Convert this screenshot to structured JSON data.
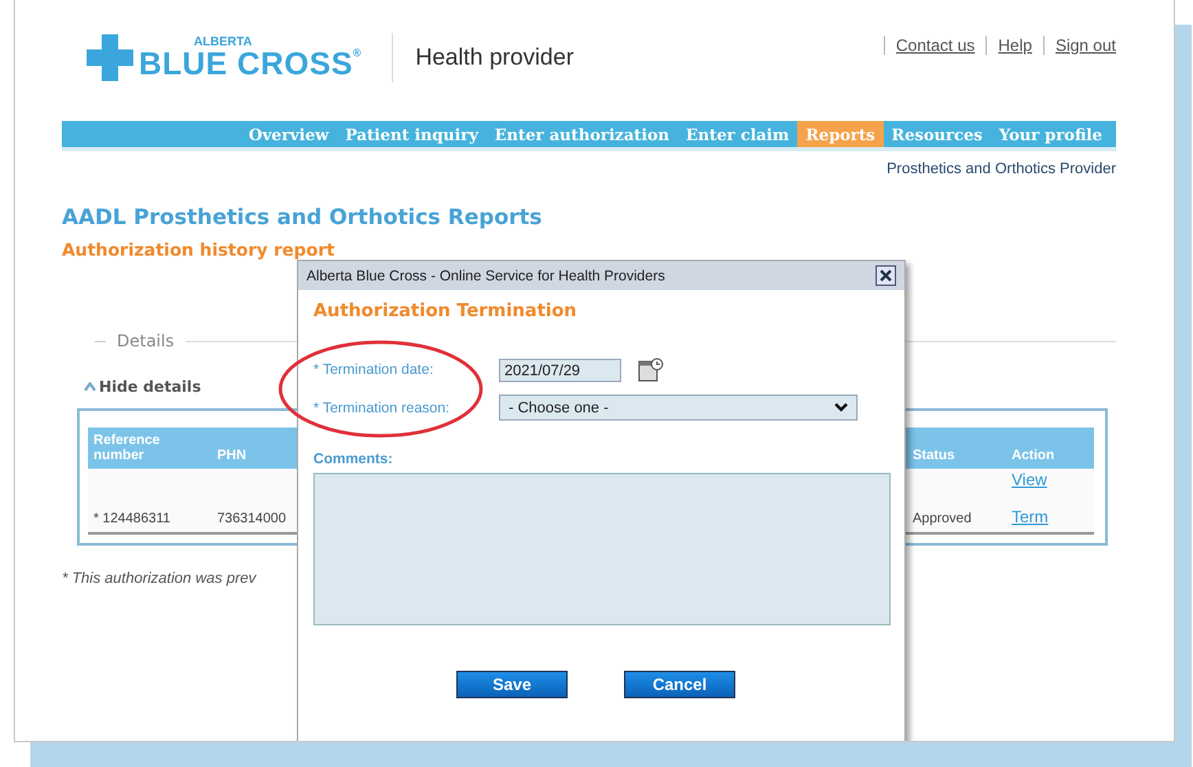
{
  "header": {
    "logo": {
      "top": "ALBERTA",
      "name": "BLUE CROSS",
      "mark": "®"
    },
    "portal": "Health provider",
    "links": [
      "Contact us",
      "Help",
      "Sign out"
    ]
  },
  "nav": [
    {
      "label": "Overview",
      "selected": false
    },
    {
      "label": "Patient inquiry",
      "selected": false
    },
    {
      "label": "Enter authorization",
      "selected": false
    },
    {
      "label": "Enter claim",
      "selected": false
    },
    {
      "label": "Reports",
      "selected": true
    },
    {
      "label": "Resources",
      "selected": false
    },
    {
      "label": "Your profile",
      "selected": false
    }
  ],
  "provider_type": "Prosthetics and Orthotics Provider",
  "page_title": "AADL Prosthetics and Orthotics Reports",
  "subtitle": "Authorization history report",
  "details": {
    "legend": "Details",
    "toggle": "Hide details",
    "expanded": true
  },
  "table": {
    "columns": [
      "Reference number",
      "PHN",
      "Status",
      "Action"
    ],
    "rows": [
      {
        "reference": "* 124486311",
        "phn": "736314000",
        "status": "Approved",
        "actions": [
          "View",
          "Term"
        ]
      }
    ]
  },
  "footnote": "* This authorization was prev",
  "dialog": {
    "title": "Alberta Blue Cross - Online Service for Health Providers",
    "heading": "Authorization Termination",
    "date_label": "* Termination date:",
    "date_value": "2021/07/29",
    "reason_label": "* Termination reason:",
    "reason_value": "- Choose one -",
    "comments_label": "Comments:",
    "buttons": [
      "Save",
      "Cancel"
    ]
  }
}
